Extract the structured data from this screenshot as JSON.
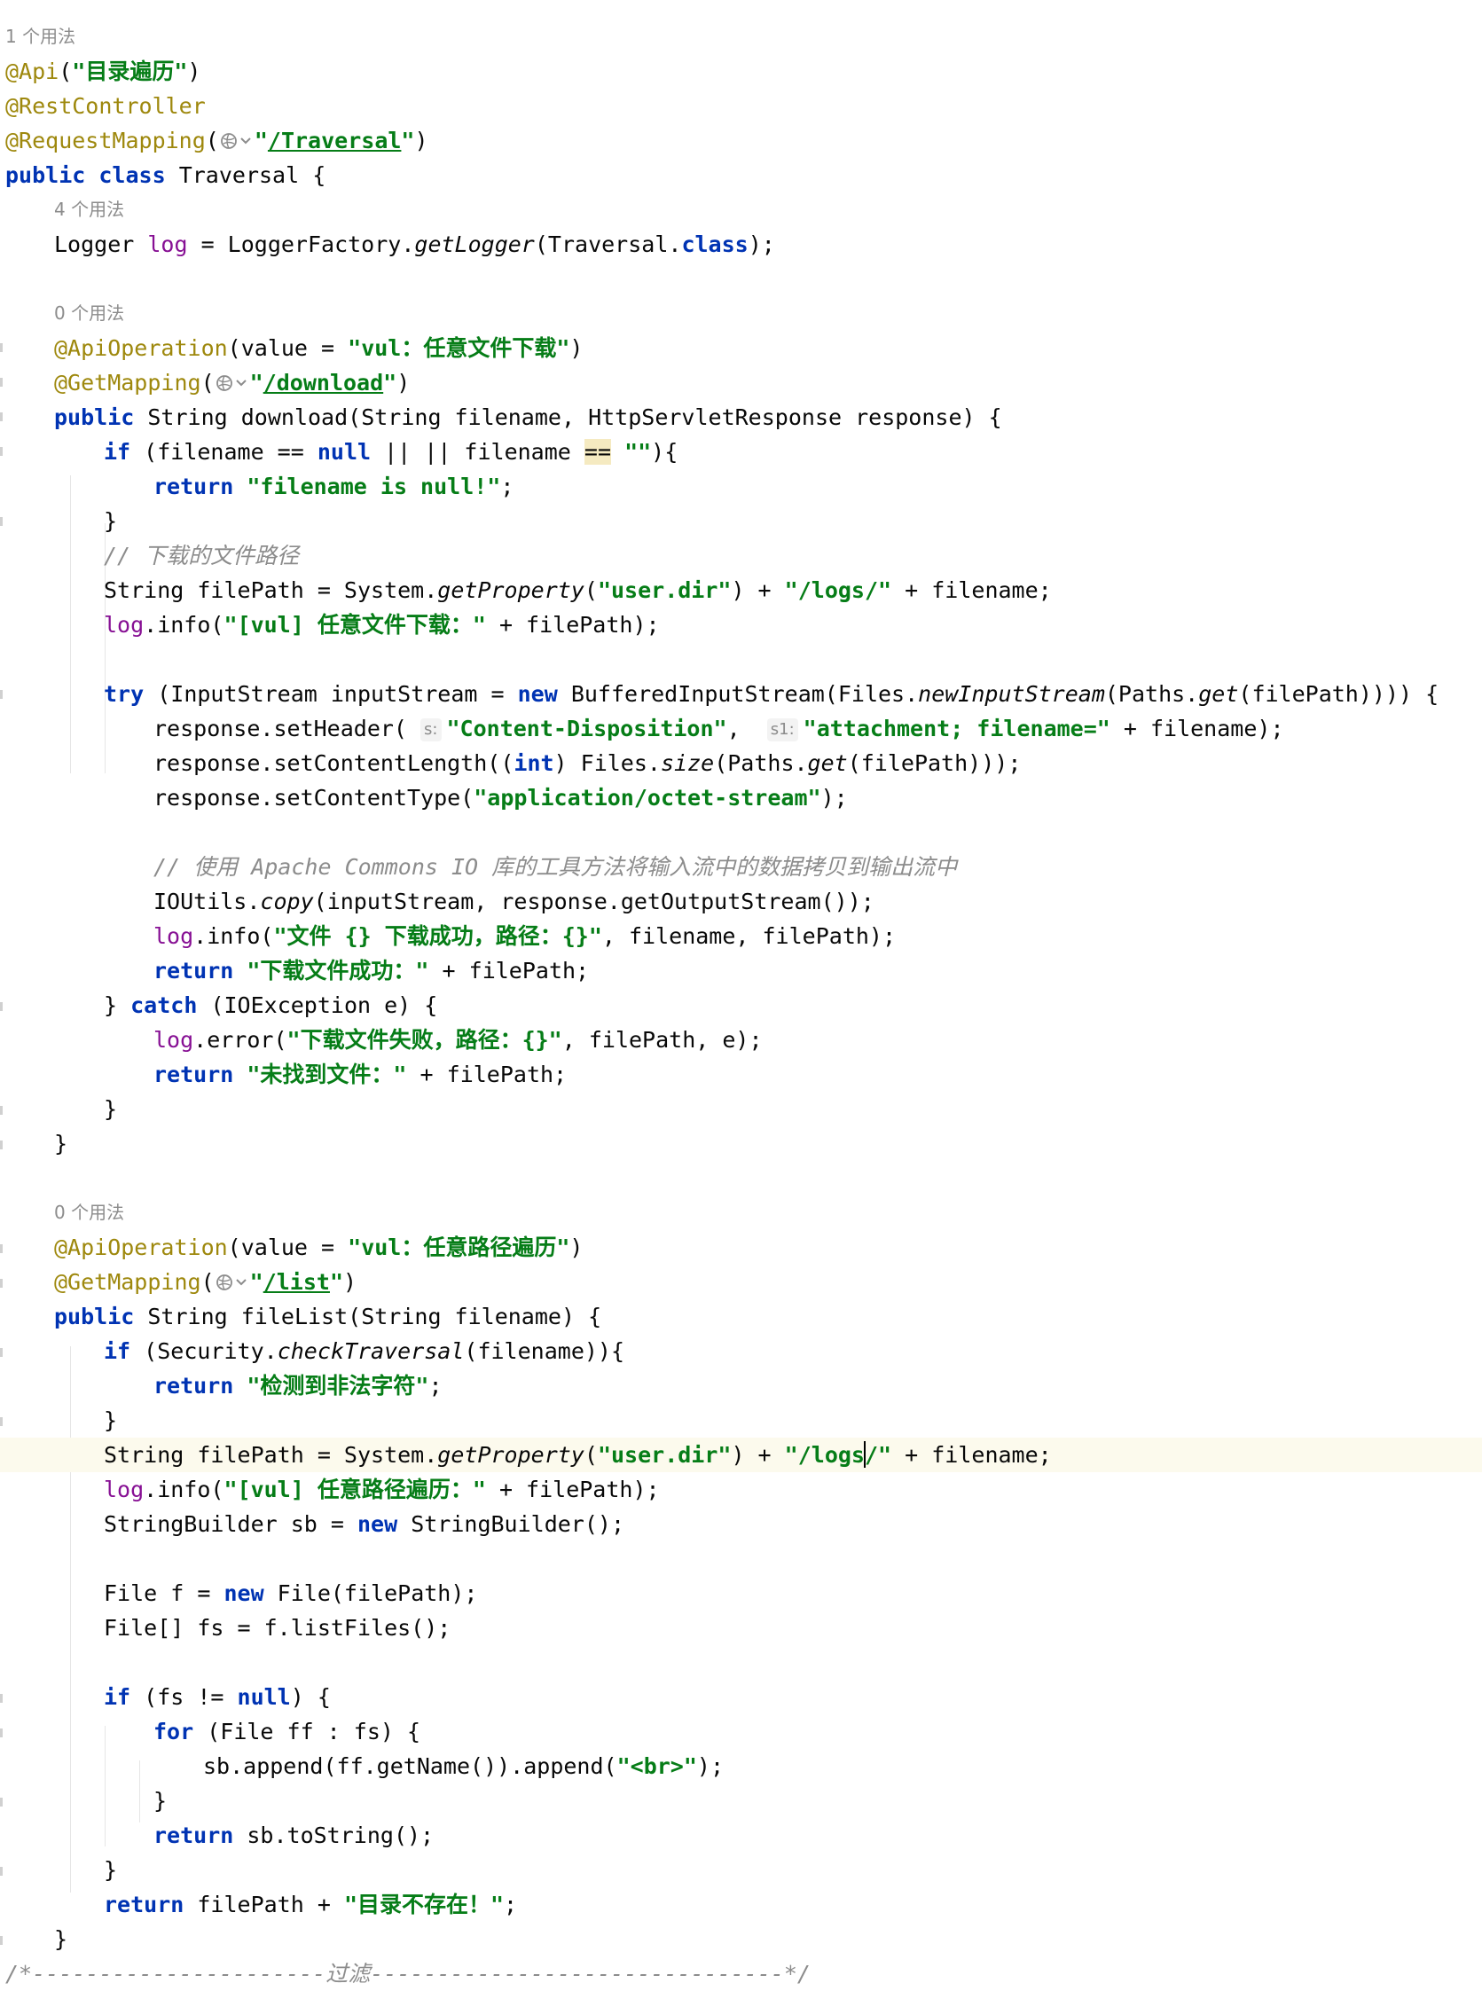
{
  "inlay_hints": {
    "class_usages": "1 个用法",
    "log_usages": "4 个用法",
    "download_usages": "0 个用法",
    "filelist_usages": "0 个用法"
  },
  "code": {
    "api_annotation": "@Api",
    "api_value": "\"目录遍历\"",
    "rest_controller": "@RestController",
    "request_mapping": "@RequestMapping",
    "request_mapping_url": "/Traversal",
    "class_decl_name": "Traversal",
    "logger_type": "Logger ",
    "logger_field": "log",
    "logger_factory": "LoggerFactory.",
    "get_logger": "getLogger",
    "traversal_class": "(Traversal.",
    "download_op_value": "\"vul：任意文件下载\"",
    "get_mapping": "@GetMapping",
    "download_url": "/download",
    "download_sig": "String download(String filename, HttpServletResponse response) {",
    "null_check_a": "(filename == ",
    "null_check_b": " || filename ",
    "null_msg": "\"filename is null!\"",
    "comment_path": "// 下载的文件路径",
    "filepath_decl": "String filePath = System.",
    "get_property": "getProperty",
    "user_dir": "\"user.dir\"",
    "logs_dir": "\"/logs/\"",
    "filename_tail": " + filename;",
    "log_info_download": "\"[vul] 任意文件下载：\"",
    "try_stream_a": "(InputStream inputStream = ",
    "try_stream_b": " BufferedInputStream(Files.",
    "new_input_stream": "newInputStream",
    "paths_get": "(Paths.",
    "get_call": "get",
    "filepath_close": "(filePath)))) {",
    "set_header": "response.setHeader(",
    "hint_s": "s:",
    "content_disposition": "\"Content-Disposition\"",
    "hint_s1": "s1:",
    "attachment": "\"attachment; filename=\"",
    "plus_filename": " + filename);",
    "set_content_length": "response.setContentLength((",
    "files_size": ") Files.",
    "size_call": "size",
    "set_content_type": "response.setContentType(",
    "octet_stream": "\"application/octet-stream\"",
    "comment_commons": "// 使用 Apache Commons IO 库的工具方法将输入流中的数据拷贝到输出流中",
    "ioutils": "IOUtils.",
    "copy_call": "copy",
    "copy_args": "(inputStream, response.getOutputStream());",
    "log_success_msg": "\"文件 {} 下载成功，路径：{}\"",
    "log_success_args": ", filename, filePath);",
    "return_success": "\"下载文件成功：\"",
    "plus_filepath": " + filePath;",
    "catch_clause": "(IOException e) {",
    "log_error_msg": "\"下载文件失败，路径：{}\"",
    "log_error_args": ", filePath, e);",
    "return_not_found": "\"未找到文件：\"",
    "list_op_value": "\"vul：任意路径遍历\"",
    "list_url": "/list",
    "filelist_sig": "String fileList(String filename) {",
    "security_check": "(Security.",
    "check_traversal": "checkTraversal",
    "check_tail": "(filename)){",
    "illegal_chars": "\"检测到非法字符\"",
    "logs_part1": "\"/logs",
    "logs_part2": "/\"",
    "log_info_list": "\"[vul] 任意路径遍历：\"",
    "sb_decl": "StringBuilder sb = ",
    "sb_new": " StringBuilder();",
    "file_decl": "File f = ",
    "file_new": " File(filePath);",
    "files_array": "File[] fs = f.listFiles();",
    "fs_check": "(fs != ",
    "for_each": "(File ff : fs) {",
    "sb_append": "sb.append(ff.getName()).append(",
    "br_tag": "\"<br>\"",
    "sb_tostring": "sb.toString();",
    "return_not_exist": "\"目录不存在！\"",
    "filter_comment": "/*----------------------过滤-------------------------------*/"
  },
  "colors": {
    "keyword": "#0033b3",
    "string": "#067d17",
    "annotation": "#9e880d",
    "field": "#871094",
    "comment": "#8c8c8c",
    "current_line": "#fcfaed"
  },
  "icons": [
    "web-endpoint-icon",
    "fold-marker-icon"
  ]
}
